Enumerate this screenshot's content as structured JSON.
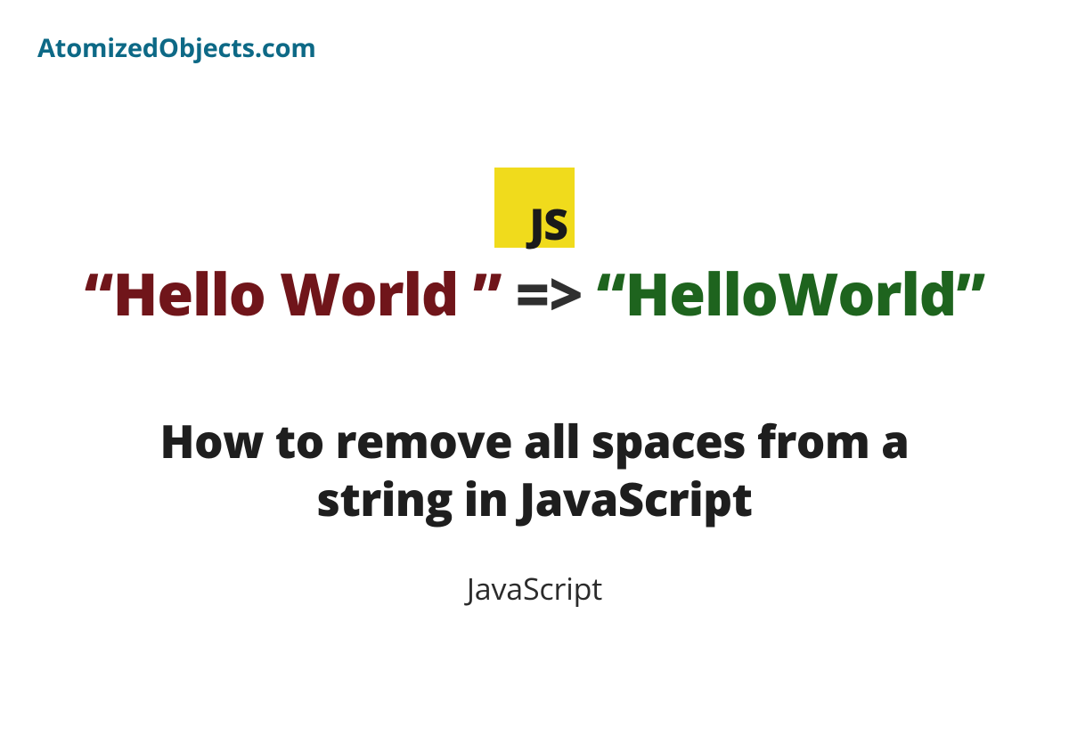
{
  "brand": "AtomizedObjects.com",
  "badge": {
    "label": "JS"
  },
  "code": {
    "before": "“Hello World ”",
    "arrow": "=>",
    "after": "“HelloWorld”"
  },
  "title": "How to remove all spaces from a string in JavaScript",
  "category": "JavaScript"
}
